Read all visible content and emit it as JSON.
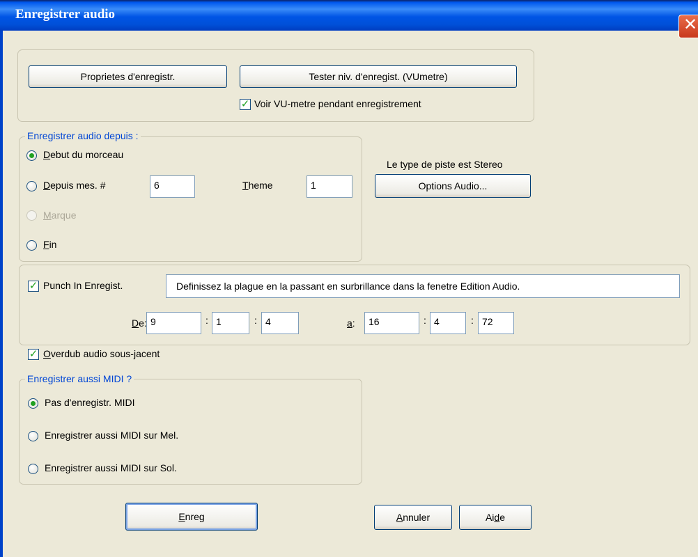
{
  "window": {
    "title": "Enregistrer audio",
    "close_glyph": "✕"
  },
  "top_group": {
    "props_button": "Proprietes d'enregistr.",
    "test_button": "Tester niv. d'enregist. (VUmetre)",
    "vu_checkbox_label": "Voir VU-metre pendant enregistrement",
    "vu_checked": true
  },
  "record_from": {
    "legend": "Enregistrer audio depuis :",
    "options": [
      {
        "prefix": "",
        "mnemonic": "D",
        "rest": "ebut du morceau",
        "checked": true,
        "enabled": true
      },
      {
        "prefix": "",
        "mnemonic": "D",
        "rest": "epuis mes. #",
        "checked": false,
        "enabled": true
      },
      {
        "prefix": "",
        "mnemonic": "M",
        "rest": "arque",
        "checked": false,
        "enabled": false
      },
      {
        "prefix": "",
        "mnemonic": "F",
        "rest": "in",
        "checked": false,
        "enabled": true
      }
    ],
    "bar_value": "6",
    "theme_mnemonic": "T",
    "theme_rest": "heme",
    "theme_value": "1"
  },
  "track": {
    "type_text": "Le type de piste est Stereo",
    "options_button": "Options Audio..."
  },
  "punch": {
    "checkbox_label": "Punch In Enregist.",
    "checked": true,
    "hint": "Definissez la plague en la passant en surbrillance dans la fenetre Edition Audio.",
    "from_mnemonic": "D",
    "from_rest": "e:",
    "from": [
      "9",
      "1",
      "4"
    ],
    "to_mnemonic": "a",
    "to_rest": ":",
    "to": [
      "16",
      "4",
      "72"
    ],
    "separator": ":"
  },
  "overdub": {
    "mnemonic": "O",
    "rest": "verdub audio sous-jacent",
    "checked": true
  },
  "midi": {
    "legend": "Enregistrer aussi MIDI ?",
    "options": [
      {
        "label": "Pas d'enregistr. MIDI",
        "checked": true
      },
      {
        "label": "Enregistrer aussi MIDI sur Mel.",
        "checked": false
      },
      {
        "label": "Enregistrer aussi MIDI sur Sol.",
        "checked": false
      }
    ]
  },
  "footer": {
    "record_mnemonic": "E",
    "record_rest": "nreg",
    "cancel_mnemonic": "A",
    "cancel_rest": "nnuler",
    "help_pre": "Ai",
    "help_mnemonic": "d",
    "help_post": "e"
  },
  "colors": {
    "title_bar": "#0058ee",
    "dialog_bg": "#ece9d8",
    "legend_text": "#0046d5",
    "check_mark": "#21a121",
    "close_button": "#c8381c"
  }
}
